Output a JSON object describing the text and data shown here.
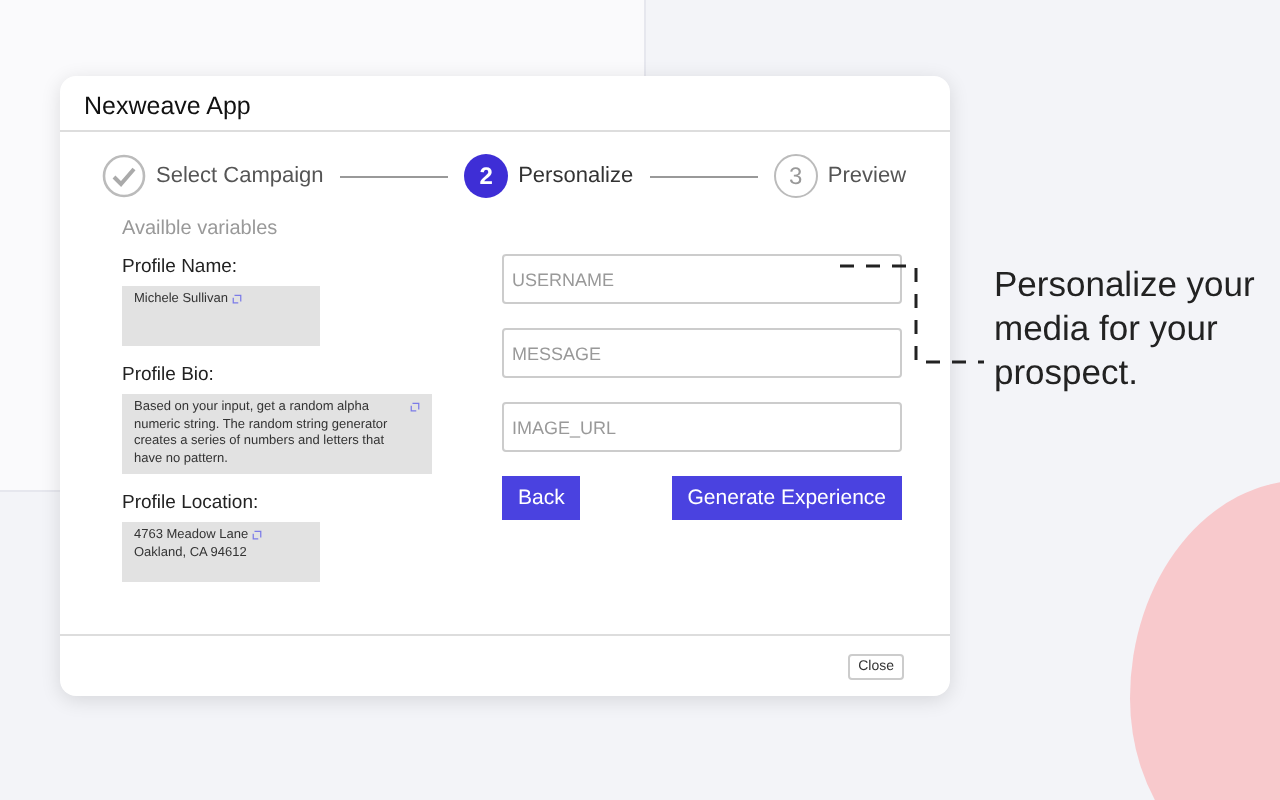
{
  "window": {
    "title": "Nexweave App"
  },
  "steps": [
    {
      "kind": "done",
      "label": "Select Campaign"
    },
    {
      "kind": "active",
      "number": "2",
      "label": "Personalize"
    },
    {
      "kind": "todo",
      "number": "3",
      "label": "Preview"
    }
  ],
  "variables": {
    "heading": "Availble variables",
    "items": [
      {
        "label": "Profile Name:",
        "lines": [
          "Michele Sullivan"
        ]
      },
      {
        "label": "Profile Bio:",
        "lines": [
          "Based on your input, get a random alpha numeric string. The random string generator creates a series of numbers and letters that have no pattern."
        ]
      },
      {
        "label": "Profile Location:",
        "lines": [
          "4763 Meadow Lane",
          "Oakland, CA 94612"
        ]
      }
    ]
  },
  "fields": [
    {
      "placeholder": "USERNAME"
    },
    {
      "placeholder": "MESSAGE"
    },
    {
      "placeholder": "IMAGE_URL"
    }
  ],
  "buttons": {
    "back": "Back",
    "generate": "Generate Experience"
  },
  "footer": {
    "close": "Close"
  },
  "caption": "Personalize your media for your prospect."
}
